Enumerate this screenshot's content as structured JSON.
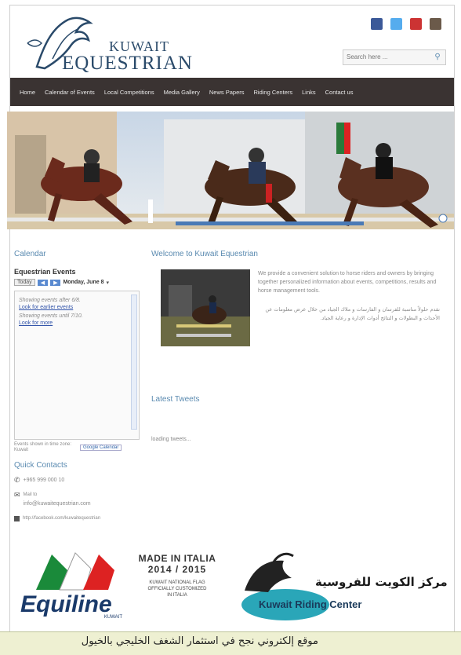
{
  "header": {
    "logo_line1": "KUWAIT",
    "logo_line2": "EQUESTRIAN",
    "search_placeholder": "Search here ...",
    "search_icon": "search-icon",
    "social_icons": [
      "facebook-icon",
      "twitter-icon",
      "youtube-icon",
      "instagram-icon"
    ],
    "social_colors": [
      "#3b5998",
      "#55acee",
      "#cc3333",
      "#6b5a4a"
    ]
  },
  "nav": {
    "items": [
      "Home",
      "Calendar of Events",
      "Local Competitions",
      "Media Gallery",
      "News Papers",
      "Riding Centers",
      "Links",
      "Contact us"
    ]
  },
  "sidebar": {
    "calendar_title": "Calendar",
    "events_title": "Equestrian Events",
    "today_label": "Today",
    "date_label": "Monday, June 8",
    "showing_after": "Showing events after 6/8.",
    "look_earlier": "Look for earlier events",
    "showing_until": "Showing events until 7/10.",
    "look_more": "Look for more",
    "events_shown": "Events shown in time zone: Kuwait",
    "google_calendar": "Google Calendar",
    "quick_contacts_title": "Quick Contacts",
    "phone": "+965 999 000 10",
    "mail_label": "Mail to",
    "email": "info@kuwaitequestrian.com",
    "facebook_url": "http://facebook.com/kuwaitequestrian"
  },
  "main": {
    "welcome_title": "Welcome to Kuwait Equestrian",
    "welcome_en": "We provide a convenient solution to horse riders and owners by bringing together personalized information about events, competitions, results and horse management tools.",
    "welcome_ar": "نقدم حلولاً مناسبة للفرسان و الفارسات و ملاك الجياد من خلال عرض معلومات عن الأحداث و البطولات و النتائج أدوات الإدارة و رعاية الجياد.",
    "tweets_title": "Latest Tweets",
    "tweets_loading": "loading tweets..."
  },
  "footer": {
    "equiline": "Equiline",
    "kuwait_small": "KUWAIT",
    "made_in": "MADE IN ITALIA",
    "year": "2014 / 2015",
    "supplier": "KUWAIT NATIONAL FLAG OFFICIALLY CUSTOMIZED IN ITALIA",
    "riding_center_ar": "مركز الكويت للفروسية",
    "riding_center_en": "Kuwait Riding Center"
  },
  "caption": {
    "text": "موقع إلكتروني نجح في استثمار الشغف الخليجي بالخيول"
  }
}
